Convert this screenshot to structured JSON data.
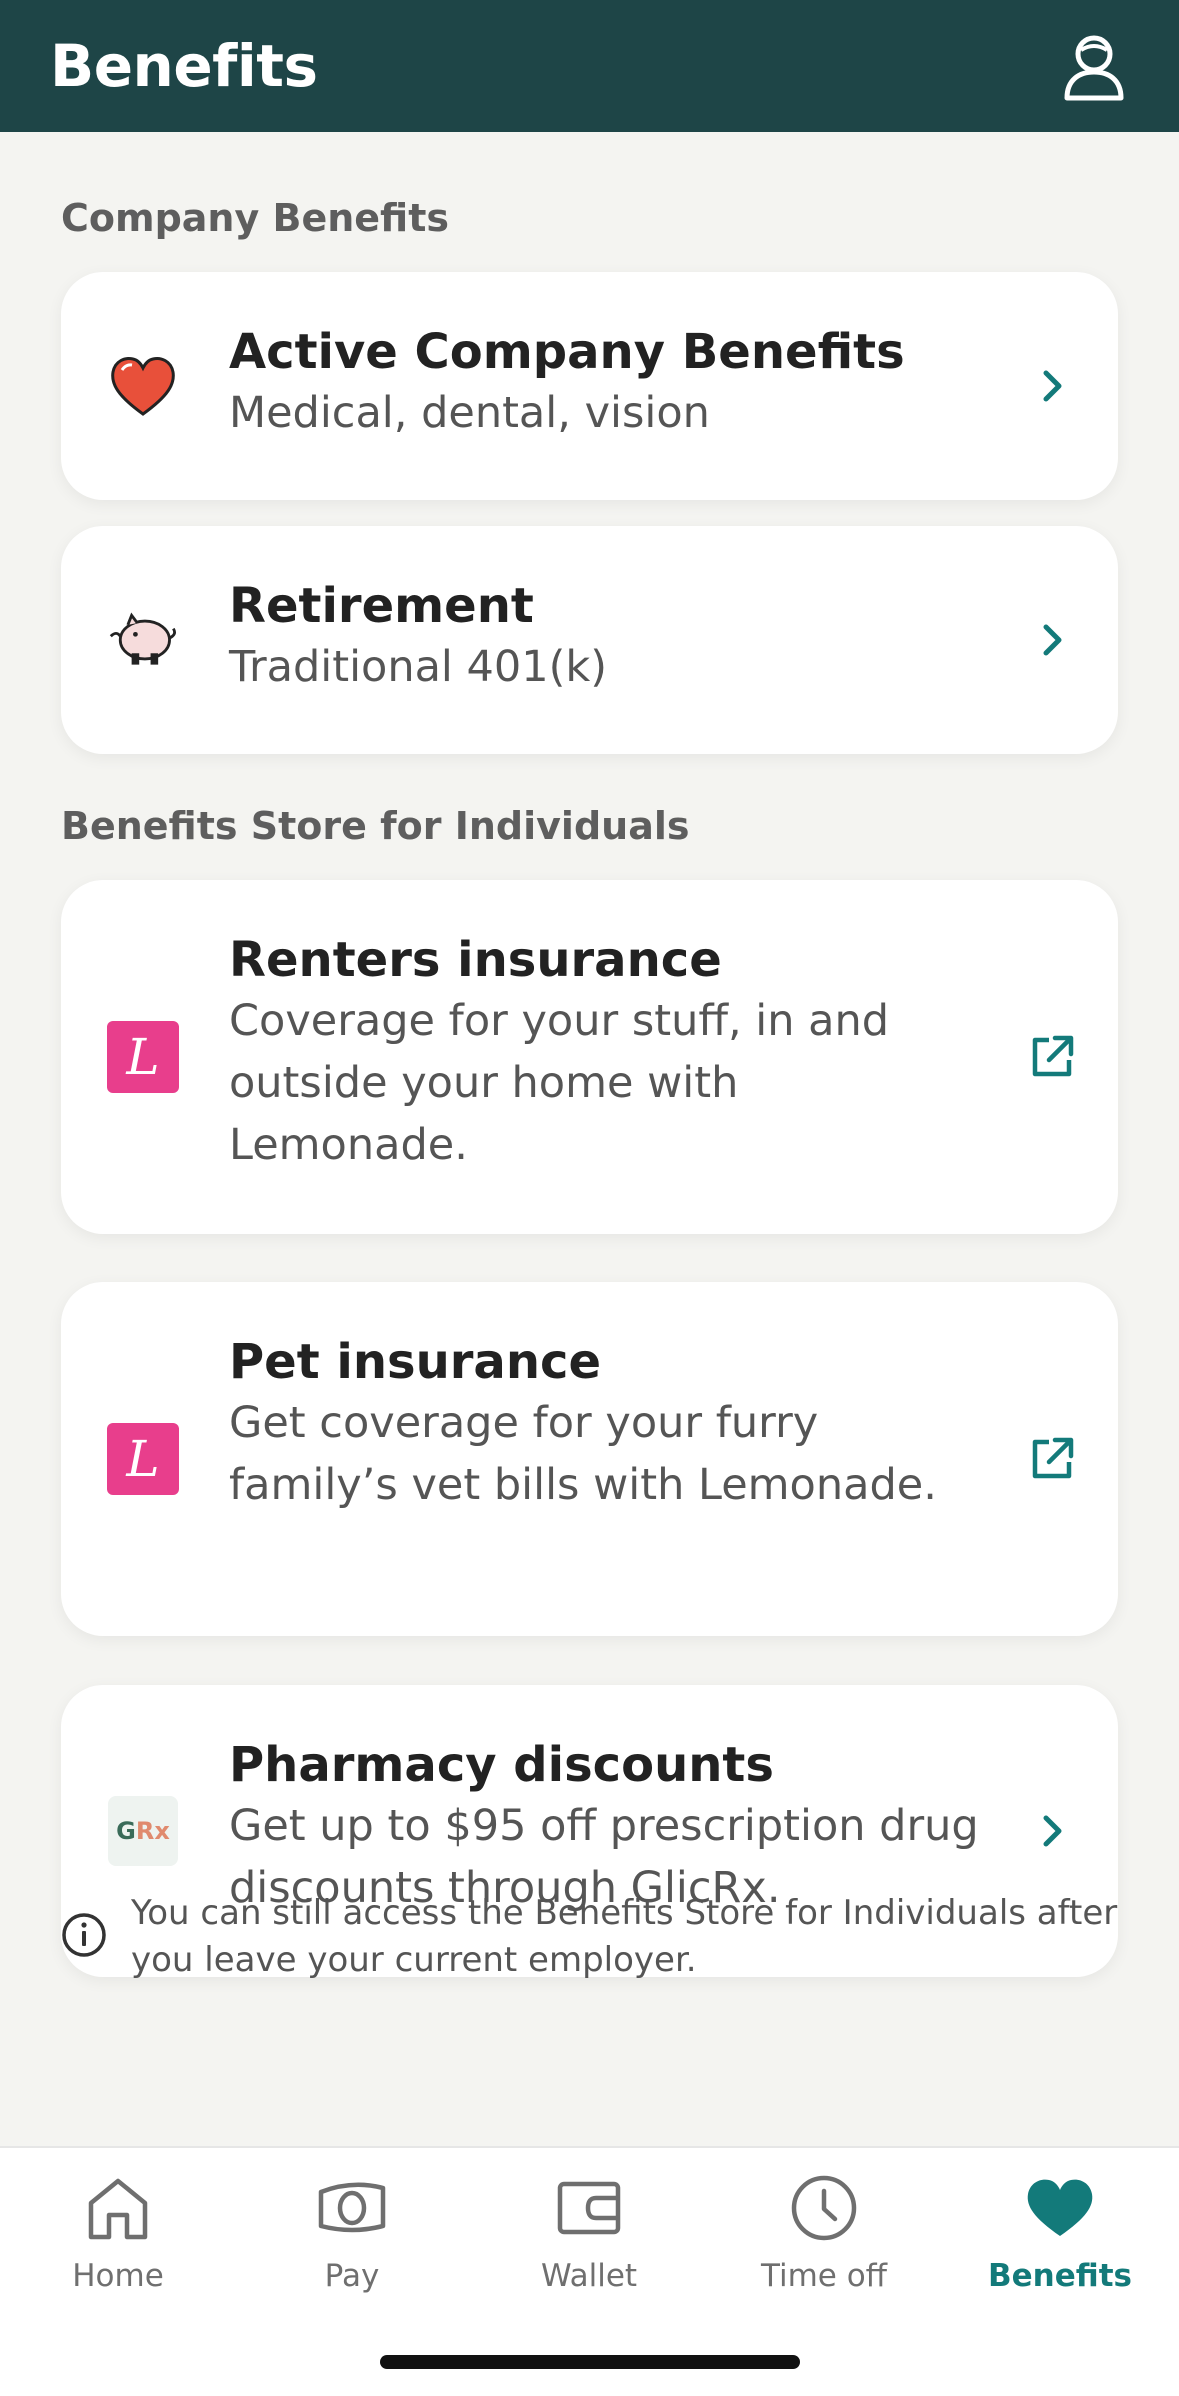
{
  "header": {
    "title": "Benefits"
  },
  "colors": {
    "header_bg": "#1e4547",
    "accent": "#137a7a",
    "lemonade": "#e83e8c",
    "heart": "#e8503a"
  },
  "sections": {
    "company": {
      "title": "Company Benefits"
    },
    "store": {
      "title": "Benefits Store for Individuals"
    }
  },
  "cards": [
    {
      "title": "Active Company Benefits",
      "sub": "Medical, dental, vision",
      "icon": "heart-icon",
      "action": "chevron-right-icon"
    },
    {
      "title": "Retirement",
      "sub": "Traditional 401(k)",
      "icon": "piggy-bank-icon",
      "action": "chevron-right-icon"
    },
    {
      "title": "Renters insurance",
      "sub": "Coverage for your stuff, in and outside your home with Lemonade.",
      "icon": "lemonade-logo",
      "logo_text": "L",
      "action": "external-link-icon"
    },
    {
      "title": "Pet insurance",
      "sub": "Get coverage for your furry family’s vet bills with Lemonade.",
      "icon": "lemonade-logo",
      "logo_text": "L",
      "action": "external-link-icon"
    },
    {
      "title": "Pharmacy discounts",
      "sub": "Get up to $95 off prescription drug discounts through GlicRx.",
      "icon": "glicrx-logo",
      "logo_g": "G",
      "logo_rx": "Rx",
      "action": "chevron-right-icon"
    }
  ],
  "info": {
    "text": "You can still access the Benefits Store for Individuals after you leave your current employer."
  },
  "tabs": [
    {
      "label": "Home",
      "icon": "home-icon",
      "active": false
    },
    {
      "label": "Pay",
      "icon": "pay-icon",
      "active": false
    },
    {
      "label": "Wallet",
      "icon": "wallet-icon",
      "active": false
    },
    {
      "label": "Time off",
      "icon": "clock-icon",
      "active": false
    },
    {
      "label": "Benefits",
      "icon": "heart-icon",
      "active": true
    }
  ]
}
